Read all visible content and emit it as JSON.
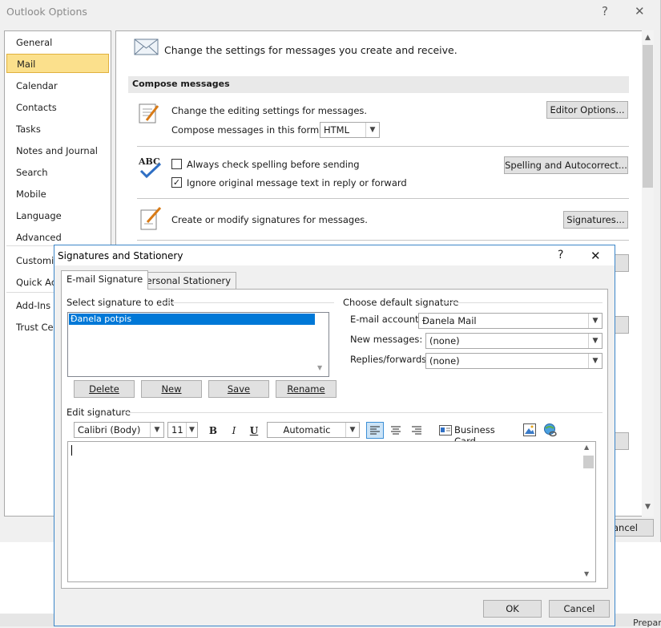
{
  "options_window": {
    "title": "Outlook Options",
    "help_glyph": "?",
    "close_glyph": "✕",
    "nav_items": [
      "General",
      "Mail",
      "Calendar",
      "Contacts",
      "Tasks",
      "Notes and Journal",
      "Search",
      "Mobile",
      "Language",
      "Advanced",
      "Customiz",
      "Quick Acc",
      "Add-Ins",
      "Trust Cen"
    ],
    "selected_nav": "Mail",
    "header_text": "Change the settings for messages you create and receive.",
    "section_compose": "Compose messages",
    "editing_text": "Change the editing settings for messages.",
    "compose_format_label": "Compose messages in this format:",
    "compose_format_value": "HTML",
    "editor_options_button": "Editor Options...",
    "always_check_spelling": "Always check spelling before sending",
    "ignore_original": "Ignore original message text in reply or forward",
    "spelling_button": "Spelling and Autocorrect...",
    "signatures_text": "Create or modify signatures for messages.",
    "signatures_button": "Signatures...",
    "cancel_partial": "ancel",
    "status_partial": "Prepari",
    "abc_icon_text": "ABC"
  },
  "signatures_dialog": {
    "title": "Signatures and Stationery",
    "help_glyph": "?",
    "close_glyph": "✕",
    "tabs": [
      "E-mail Signature",
      "Personal Stationery"
    ],
    "select_label": "Select signature to edit",
    "signatures": [
      "Đanela potpis"
    ],
    "buttons": {
      "delete": "Delete",
      "new": "New",
      "save": "Save",
      "rename": "Rename",
      "ok": "OK",
      "cancel": "Cancel"
    },
    "default_label": "Choose default signature",
    "email_account_label": "E-mail account:",
    "email_account_value": "Đanela Mail",
    "new_messages_label": "New messages:",
    "new_messages_value": "(none)",
    "replies_label": "Replies/forwards:",
    "replies_value": "(none)",
    "edit_label": "Edit signature",
    "font_value": "Calibri (Body)",
    "size_value": "11",
    "color_value": "Automatic",
    "bold": "B",
    "italic": "I",
    "underline": "U",
    "business_card": "Business Card"
  }
}
